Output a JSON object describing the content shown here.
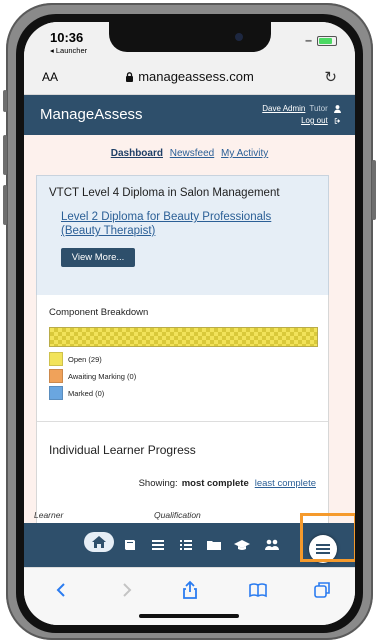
{
  "status_bar": {
    "time": "10:36",
    "back_label": "◂ Launcher"
  },
  "browser": {
    "text_size_label": "AA",
    "url": "manageassess.com"
  },
  "header": {
    "brand": "ManageAssess",
    "user_name": "Dave Admin",
    "role": "Tutor",
    "logout_label": "Log out"
  },
  "tabs": [
    "Dashboard",
    "Newsfeed",
    "My Activity"
  ],
  "qualification_card": {
    "title": "VTCT Level 4 Diploma in Salon Management",
    "link": "Level 2 Diploma for Beauty Professionals (Beauty Therapist)",
    "button": "View More..."
  },
  "breakdown": {
    "title": "Component Breakdown",
    "legend": [
      {
        "label": "Open (29)",
        "color": "#f2e35a"
      },
      {
        "label": "Awaiting Marking (0)",
        "color": "#f0a25a"
      },
      {
        "label": "Marked (0)",
        "color": "#6aa6e0"
      }
    ],
    "bar_segments": [
      {
        "label": "Open",
        "value": 29
      }
    ]
  },
  "progress": {
    "title": "Individual Learner Progress",
    "showing_label": "Showing:",
    "sort_active": "most complete",
    "sort_other": "least complete",
    "columns": [
      "Learner",
      "Qualification"
    ]
  },
  "bottom_nav_icons": [
    "home-icon",
    "book-icon",
    "list-icon",
    "ordered-list-icon",
    "folder-icon",
    "graduation-cap-icon",
    "users-icon"
  ],
  "colors": {
    "header": "#2e4f6b",
    "link": "#2b5f96",
    "highlight": "#f59a2c",
    "page_bg": "#fdf1ed"
  }
}
